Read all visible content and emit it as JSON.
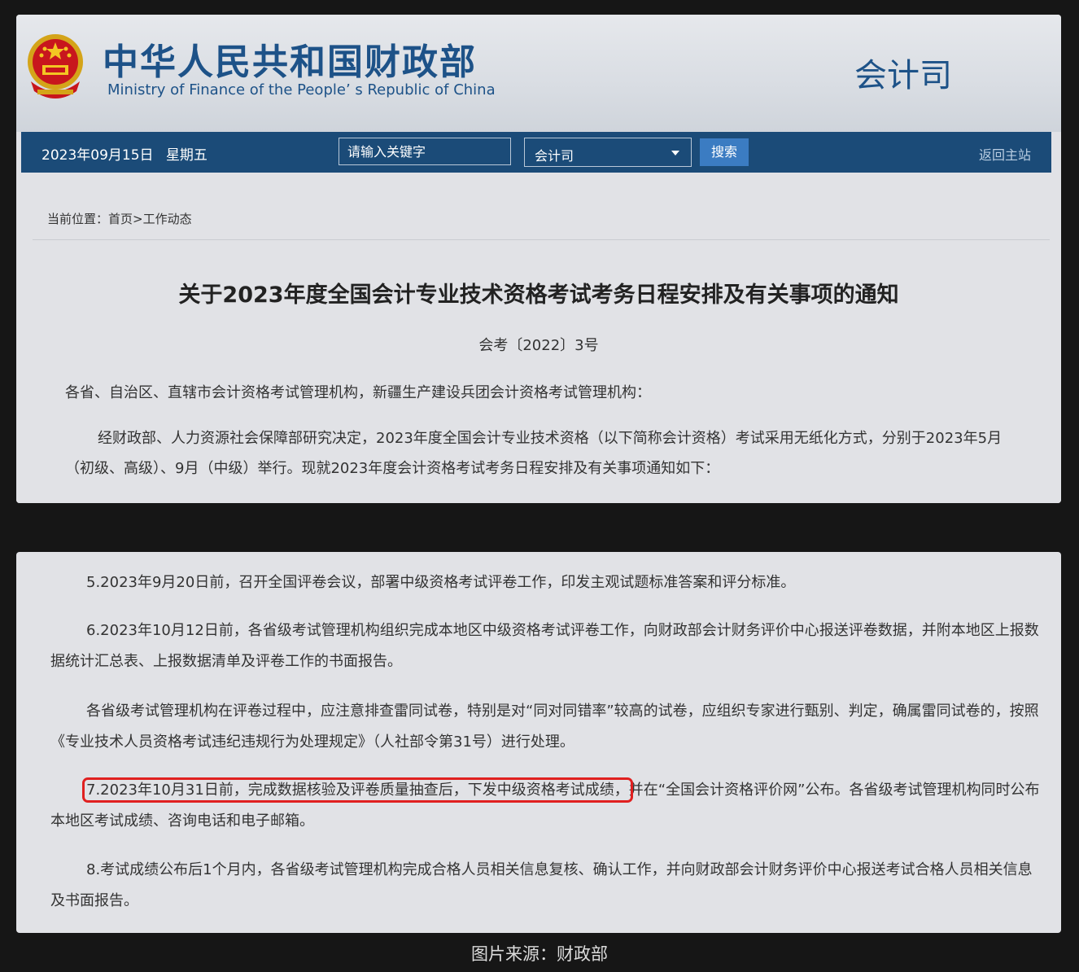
{
  "header": {
    "title_cn": "中华人民共和国财政部",
    "title_en": "Ministry of Finance of the People’ s Republic of China",
    "department": "会计司"
  },
  "nav": {
    "date": "2023年09月15日",
    "weekday": "星期五",
    "search_placeholder": "请输入关键字",
    "select_value": "会计司",
    "search_label": "搜索",
    "home_link": "返回主站"
  },
  "breadcrumb": {
    "prefix": "当前位置：",
    "home": "首页",
    "separator": ">",
    "current": "工作动态"
  },
  "article": {
    "title": "关于2023年度全国会计专业技术资格考试考务日程安排及有关事项的通知",
    "doc_number": "会考〔2022〕3号",
    "salutation": "各省、自治区、直辖市会计资格考试管理机构，新疆生产建设兵团会计资格考试管理机构：",
    "intro": "经财政部、人力资源社会保障部研究决定，2023年度全国会计专业技术资格（以下简称会计资格）考试采用无纸化方式，分别于2023年5月（初级、高级）、9月（中级）举行。现就2023年度会计资格考试考务日程安排及有关事项通知如下：",
    "item5": "5.2023年9月20日前，召开全国评卷会议，部署中级资格考试评卷工作，印发主观试题标准答案和评分标准。",
    "item6": "6.2023年10月12日前，各省级考试管理机构组织完成本地区中级资格考试评卷工作，向财政部会计财务评价中心报送评卷数据，并附本地区上报数据统计汇总表、上报数据清单及评卷工作的书面报告。",
    "note": "各省级考试管理机构在评卷过程中，应注意排查雷同试卷，特别是对“同对同错率”较高的试卷，应组织专家进行甄别、判定，确属雷同试卷的，按照《专业技术人员资格考试违纪违规行为处理规定》（人社部令第31号）进行处理。",
    "item7_highlight": "7.2023年10月31日前，完成数据核验及评卷质量抽查后，下发中级资格考试成绩，",
    "item7_rest": "并在“全国会计资格评价网”公布。各省级考试管理机构同时公布本地区考试成绩、咨询电话和电子邮箱。",
    "item8": "8.考试成绩公布后1个月内，各省级考试管理机构完成合格人员相关信息复核、确认工作，并向财政部会计财务评价中心报送考试合格人员相关信息及书面报告。"
  },
  "caption": "图片来源：财政部",
  "colors": {
    "brand_blue": "#1d5288",
    "nav_bar": "#1b4b78",
    "search_button": "#3b7cc2",
    "highlight_outline": "#e02020"
  }
}
